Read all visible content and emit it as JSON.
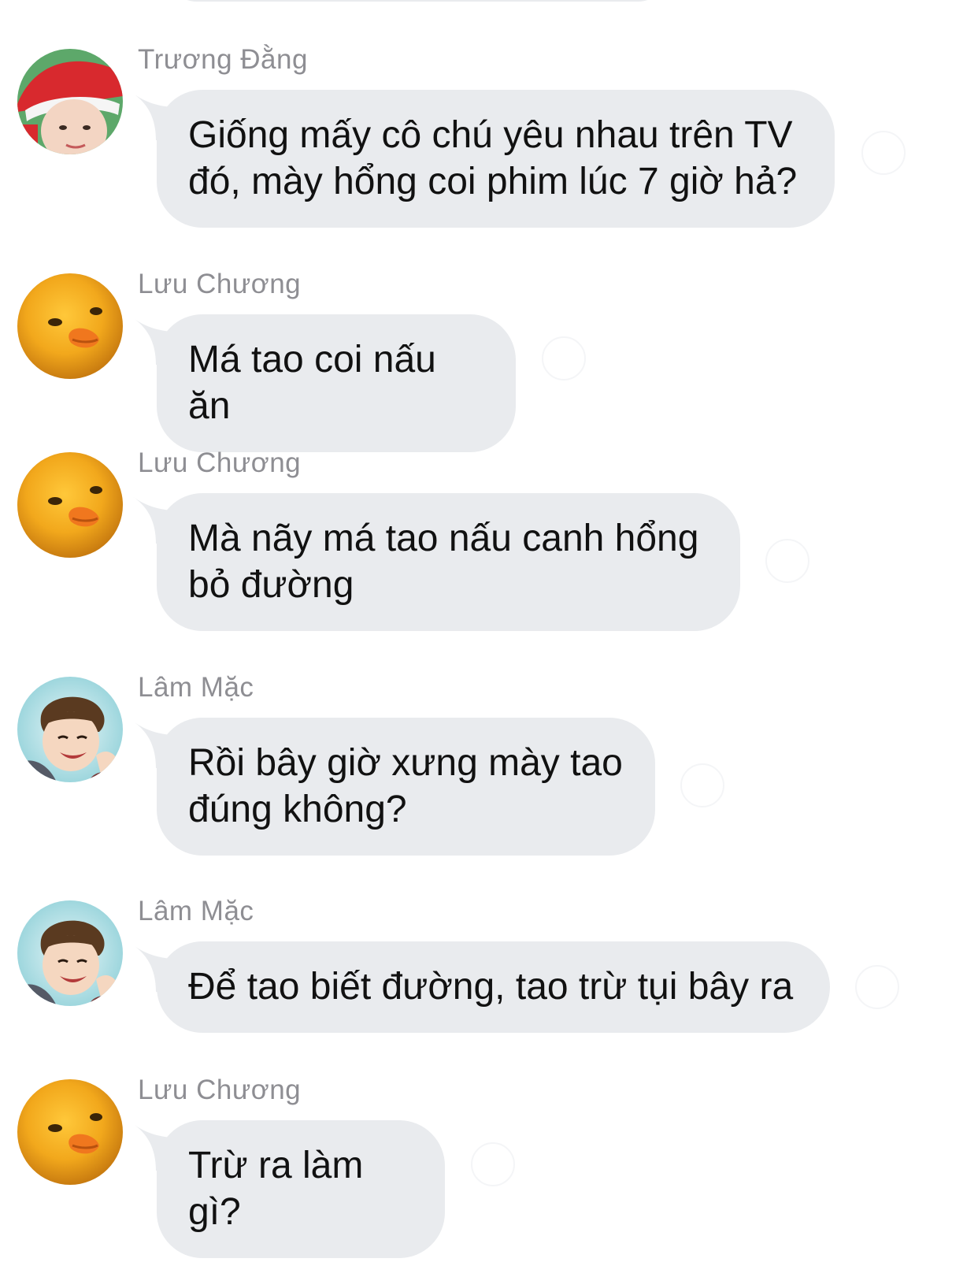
{
  "colors": {
    "bubble_bg": "#e9ebee",
    "sender_text": "#8e8e93",
    "message_text": "#111111",
    "background": "#ffffff"
  },
  "messages": [
    {
      "sender": "Trương Đằng",
      "avatar": "santa-hat-boy-avatar",
      "text": "Giống mấy cô chú yêu nhau trên TV\nđó, mày hổng coi phim lúc 7 giờ hả?"
    },
    {
      "sender": "Lưu Chương",
      "avatar": "duck-avatar",
      "text": "Má tao coi nấu ăn"
    },
    {
      "sender": "Lưu Chương",
      "avatar": "duck-avatar",
      "text": "Mà nãy má tao nấu canh hổng\nbỏ đường"
    },
    {
      "sender": "Lâm Mặc",
      "avatar": "waving-boy-avatar",
      "text": "Rồi bây giờ xưng mày tao\nđúng không?"
    },
    {
      "sender": "Lâm Mặc",
      "avatar": "waving-boy-avatar",
      "text": "Để tao biết đường, tao trừ tụi bây ra"
    },
    {
      "sender": "Lưu Chương",
      "avatar": "duck-avatar",
      "text": "Trừ ra làm gì?"
    }
  ]
}
